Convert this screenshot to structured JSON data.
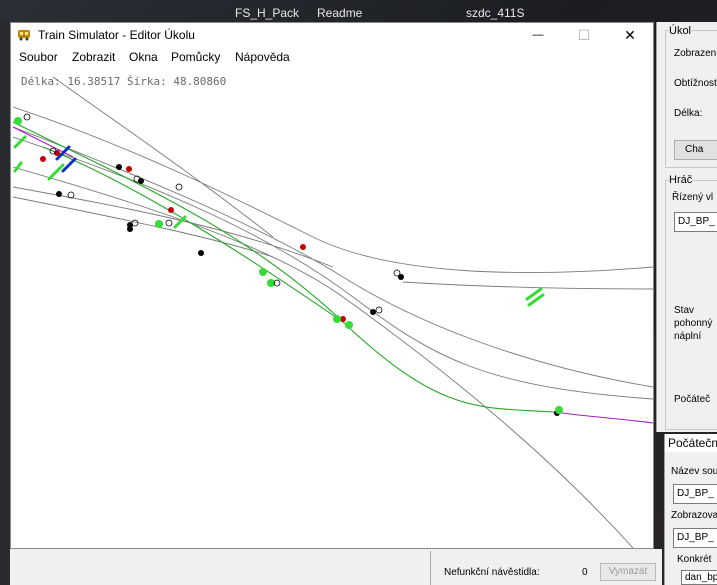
{
  "taskbar": {
    "items": [
      "FS_H_Pack",
      "Readme",
      "szdc_411S"
    ]
  },
  "window": {
    "title": "Train Simulator - Editor Úkolu",
    "minimize_glyph": "—",
    "maximize_glyph": "☐",
    "close_glyph": "✕"
  },
  "menu": {
    "items": [
      "Soubor",
      "Zobrazit",
      "Okna",
      "Pomůcky",
      "Nápověda"
    ]
  },
  "map": {
    "coords_label": "Délka: 16.38517 Šírka: 48.80860"
  },
  "ukol_panel": {
    "group_title": "Úkol",
    "zobrazeni_label": "Zobrazen",
    "obtiznost_label": "Obtížnost",
    "delka_label": "Délka:",
    "button_label": "Cha"
  },
  "hrac_panel": {
    "group_title": "Hráč",
    "rizeny_label": "Řízený vl",
    "rizeny_value": "DJ_BP_",
    "stav_label_1": "Stav",
    "stav_label_2": "pohonný",
    "stav_label_3": "náplní",
    "pocatecni_label": "Počáteč"
  },
  "pocatecni_panel": {
    "title": "Počáteční",
    "nazev_label": "Název sou",
    "nazev_value": "DJ_BP_",
    "zobrazovat_label": "Zobrazova",
    "zobrazovat_value": "DJ_BP_",
    "konkretni_label": "Konkrét",
    "konkretni_value": "dan_bp"
  },
  "status": {
    "nefunkcni_label": "Nefunkční návěstidla:",
    "nefunkcni_value": "0",
    "vymazat_label": "Vymazat"
  },
  "colors": {
    "track": "#7a7a7a",
    "route_green": "#22a822",
    "route_purple": "#a020c0",
    "signal_green": "#33dd33",
    "node_red": "#c00000",
    "node_black": "#000000",
    "marker_blue": "#1030c0"
  }
}
